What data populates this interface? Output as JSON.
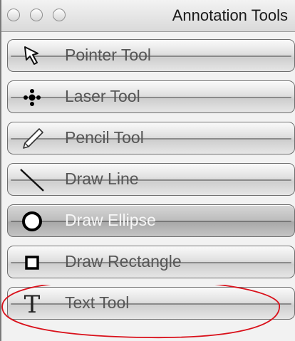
{
  "window": {
    "title": "Annotation Tools"
  },
  "tools": [
    {
      "label": "Pointer Tool",
      "icon": "pointer-arrow-icon"
    },
    {
      "label": "Laser Tool",
      "icon": "laser-dots-icon"
    },
    {
      "label": "Pencil Tool",
      "icon": "pencil-icon"
    },
    {
      "label": "Draw Line",
      "icon": "diagonal-line-icon"
    },
    {
      "label": "Draw Ellipse",
      "icon": "circle-icon",
      "selected": true
    },
    {
      "label": "Draw Rectangle",
      "icon": "square-icon"
    },
    {
      "label": "Text Tool",
      "icon": "text-t-icon"
    }
  ],
  "colors": {
    "annotation": "#d9101a",
    "label": "#565656",
    "selected_label": "#f7f7f7"
  }
}
